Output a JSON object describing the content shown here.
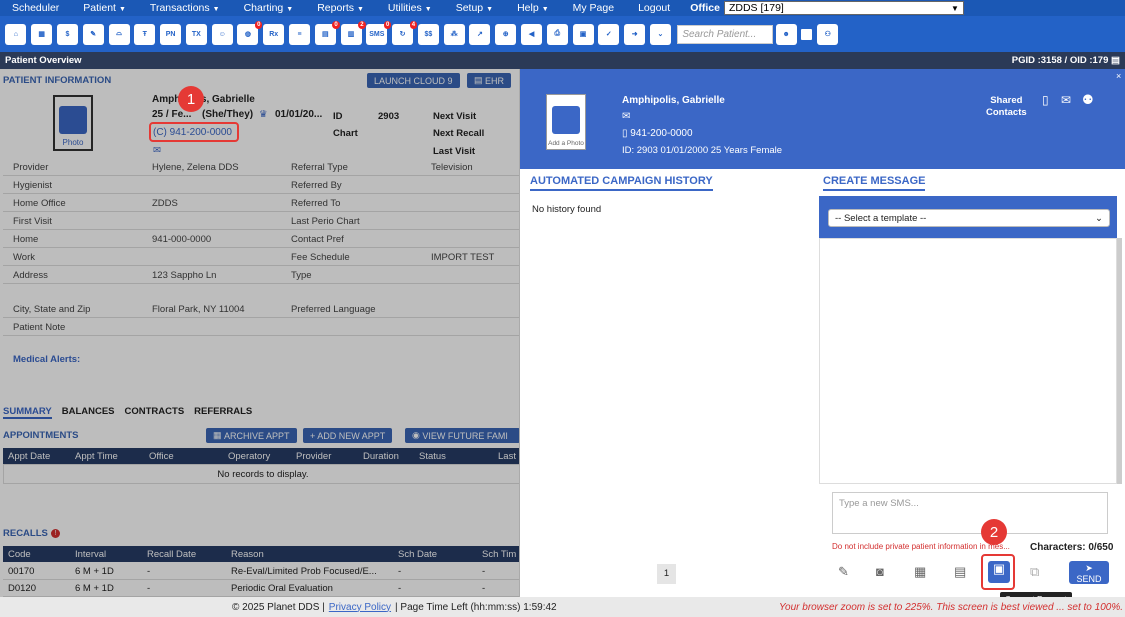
{
  "menu": {
    "items": [
      "Scheduler",
      "Patient",
      "Transactions",
      "Charting",
      "Reports",
      "Utilities",
      "Setup",
      "Help",
      "My Page",
      "Logout"
    ],
    "office_label": "Office",
    "office_value": "ZDDS [179]"
  },
  "toolbar": {
    "icons": [
      "home-icon",
      "calendar-icon",
      "dollar-icon",
      "edit-icon",
      "tooth-icon",
      "implant-icon",
      "pn-icon",
      "tx-icon",
      "patient-add-icon",
      "globe-icon",
      "rx-icon",
      "message-icon",
      "chat-icon",
      "document-icon",
      "sms-icon",
      "refresh-icon",
      "ss-icon",
      "network-icon",
      "chart-icon",
      "globe-alt-icon",
      "megaphone-icon",
      "print-icon",
      "print-alt-icon",
      "shield-check-icon",
      "shield-arrow-icon",
      "chevrons-down-icon"
    ],
    "badges": {
      "globe": "0",
      "chat": "0",
      "document": "2",
      "sms": "0",
      "refresh": "4"
    },
    "search_placeholder": "Search Patient...",
    "pn": "PN",
    "tx": "TX",
    "sms": "SMS",
    "rx": "Rx"
  },
  "titlebar": {
    "title": "Patient Overview",
    "ids": "PGID :3158  /  OID :179"
  },
  "patient": {
    "section": "PATIENT INFORMATION",
    "launch_btn": "LAUNCH CLOUD 9",
    "ehr_btn": "EHR",
    "name": "Amphipolis, Gabrielle",
    "age_gender": "25 / Fe...",
    "pronoun": "(She/They)",
    "dob": "01/01/20...",
    "phone": "(C) 941-200-0000",
    "photo_label": "Photo",
    "id_label": "ID",
    "id_value": "2903",
    "chart_label": "Chart",
    "next_visit": "Next Visit",
    "next_recall": "Next Recall",
    "last_visit": "Last Visit"
  },
  "info_rows": [
    {
      "l1": "Provider",
      "v1": "Hylene, Zelena DDS",
      "l2": "Referral Type",
      "v2": "Television"
    },
    {
      "l1": "Hygienist",
      "v1": "",
      "l2": "Referred By",
      "v2": ""
    },
    {
      "l1": "Home Office",
      "v1": "ZDDS",
      "l2": "Referred To",
      "v2": ""
    },
    {
      "l1": "First Visit",
      "v1": "",
      "l2": "Last Perio Chart",
      "v2": ""
    },
    {
      "l1": "Home",
      "v1": "941-000-0000",
      "l2": "Contact Pref",
      "v2": ""
    },
    {
      "l1": "Work",
      "v1": "",
      "l2": "Fee Schedule",
      "v2": "IMPORT TEST"
    },
    {
      "l1": "Address",
      "v1": "123 Sappho Ln",
      "l2": "Type",
      "v2": ""
    },
    {
      "l1": "City, State and Zip",
      "v1": "Floral Park, NY 11004",
      "l2": "Preferred Language",
      "v2": ""
    },
    {
      "l1": "Patient Note",
      "v1": "",
      "l2": "",
      "v2": ""
    }
  ],
  "medical_alerts": "Medical Alerts:",
  "tabs": [
    "SUMMARY",
    "BALANCES",
    "CONTRACTS",
    "REFERRALS"
  ],
  "appointments": {
    "title": "APPOINTMENTS",
    "archive_btn": "ARCHIVE APPT",
    "add_btn": "+ ADD NEW APPT",
    "future_btn": "VIEW FUTURE FAMI",
    "columns": [
      "Appt Date",
      "Appt Time",
      "Office",
      "Operatory",
      "Provider",
      "Duration",
      "Status",
      "Last"
    ],
    "empty": "No records to display."
  },
  "recalls": {
    "title": "RECALLS",
    "columns": [
      "Code",
      "Interval",
      "Recall Date",
      "Reason",
      "Sch Date",
      "Sch Tim"
    ],
    "rows": [
      [
        "00170",
        "6 M + 1D",
        "-",
        "Re-Eval/Limited Prob Focused/E...",
        "-",
        "-"
      ],
      [
        "D0120",
        "6 M + 1D",
        "-",
        "Periodic Oral Evaluation",
        "-",
        "-"
      ]
    ]
  },
  "drawer": {
    "name": "Amphipolis, Gabrielle",
    "phone": "941-200-0000",
    "id_line": "ID: 2903   01/01/2000   25 Years      Female",
    "add_photo": "Add a Photo",
    "shared": "Shared",
    "contacts": "Contacts",
    "campaign_title": "AUTOMATED CAMPAIGN HISTORY",
    "no_history": "No history found",
    "create_title": "CREATE MESSAGE",
    "template_placeholder": "-- Select a template --",
    "sms_placeholder": "Type a new SMS...",
    "warning": "Do not include private patient information in mes...",
    "characters": "Characters: 0/650",
    "page": "1",
    "send": "SEND",
    "tooltip": "Consent Request"
  },
  "footer": {
    "copyright": "© 2025 Planet DDS |",
    "privacy": "Privacy Policy",
    "time": "| Page Time Left (hh:mm:ss) 1:59:42",
    "zoom_warning": "Your browser zoom is set to 225%. This screen is best viewed ... set to 100%."
  },
  "annotations": {
    "one": "1",
    "two": "2"
  }
}
